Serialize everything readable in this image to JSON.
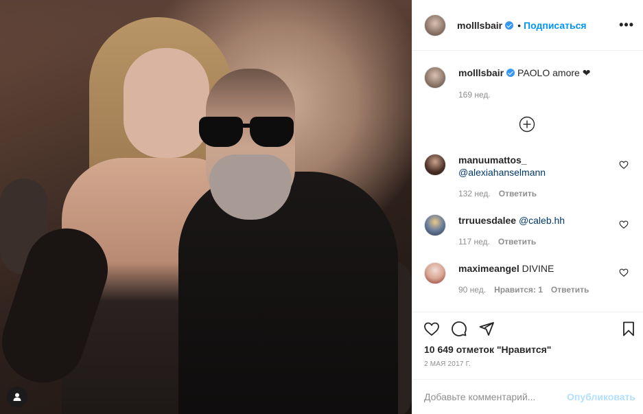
{
  "post": {
    "author": "molllsbair",
    "follow_label": "Подписаться",
    "dot": "•",
    "more_label": "•••",
    "caption": "PAOLO amore",
    "caption_heart": "❤",
    "caption_time": "169 нед."
  },
  "comments": [
    {
      "user": "manuumattos_",
      "text": "@alexiahanselmann",
      "time": "132 нед.",
      "likes": "",
      "reply": "Ответить"
    },
    {
      "user": "trruuesdalee",
      "text": "@caleb.hh",
      "time": "117 нед.",
      "likes": "",
      "reply": "Ответить"
    },
    {
      "user": "maximeangel",
      "text": "DIVINE",
      "time": "90 нед.",
      "likes": "Нравится: 1",
      "reply": "Ответить"
    }
  ],
  "footer": {
    "likes_count": "10 649 отметок \"Нравится\"",
    "date": "2 МАЯ 2017 Г.",
    "comment_placeholder": "Добавьте комментарий...",
    "publish_label": "Опубликовать"
  },
  "icons": {
    "like": "heart-icon",
    "comment": "comment-icon",
    "share": "share-icon",
    "save": "bookmark-icon",
    "load_more": "plus-circle-icon",
    "profile": "user-icon"
  },
  "colors": {
    "link_blue": "#0095f6",
    "verified_blue": "#3897f0",
    "muted": "#8e8e8e",
    "publish_disabled": "#b2dffc"
  }
}
